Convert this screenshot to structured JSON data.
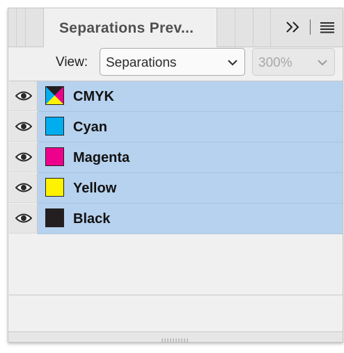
{
  "panel": {
    "tab_title": "Separations Prev...",
    "view_label": "View:",
    "view_select": {
      "value": "Separations"
    },
    "zoom_select": {
      "value": "300%"
    }
  },
  "colors": {
    "selected_row": "#b7d2ee",
    "cyan": "#00aeef",
    "magenta": "#ec008c",
    "yellow": "#fff200",
    "black": "#231f20"
  },
  "separations": [
    {
      "label": "CMYK",
      "swatch": "cmyk-composite",
      "visible": true
    },
    {
      "label": "Cyan",
      "swatch": "#00aeef",
      "visible": true
    },
    {
      "label": "Magenta",
      "swatch": "#ec008c",
      "visible": true
    },
    {
      "label": "Yellow",
      "swatch": "#fff200",
      "visible": true
    },
    {
      "label": "Black",
      "swatch": "#231f20",
      "visible": true
    }
  ],
  "icons": {
    "collapse": "double-chevron-right-icon",
    "menu": "hamburger-menu-icon",
    "visibility": "eye-icon",
    "dropdown": "chevron-down-icon"
  }
}
